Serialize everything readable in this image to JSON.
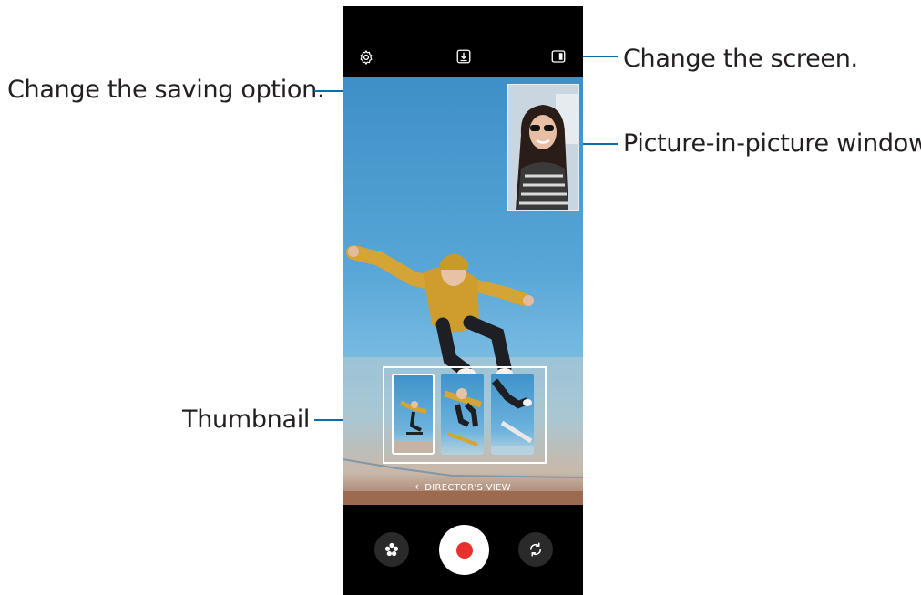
{
  "callouts": {
    "change_screen": "Change the screen.",
    "saving_option": "Change the saving option.",
    "pip_window": "Picture-in-picture window",
    "thumbnail": "Thumbnail"
  },
  "camera": {
    "directors_view_label": "DIRECTOR'S VIEW",
    "directors_view_chevron": "‹",
    "top_icons": [
      "settings-icon",
      "save-option-icon",
      "screen-layout-icon"
    ],
    "bottom_icons": [
      "effects-icon",
      "record-icon",
      "switch-camera-icon"
    ],
    "record_color": "#e8312d",
    "leader_color": "#0a6ea8"
  }
}
